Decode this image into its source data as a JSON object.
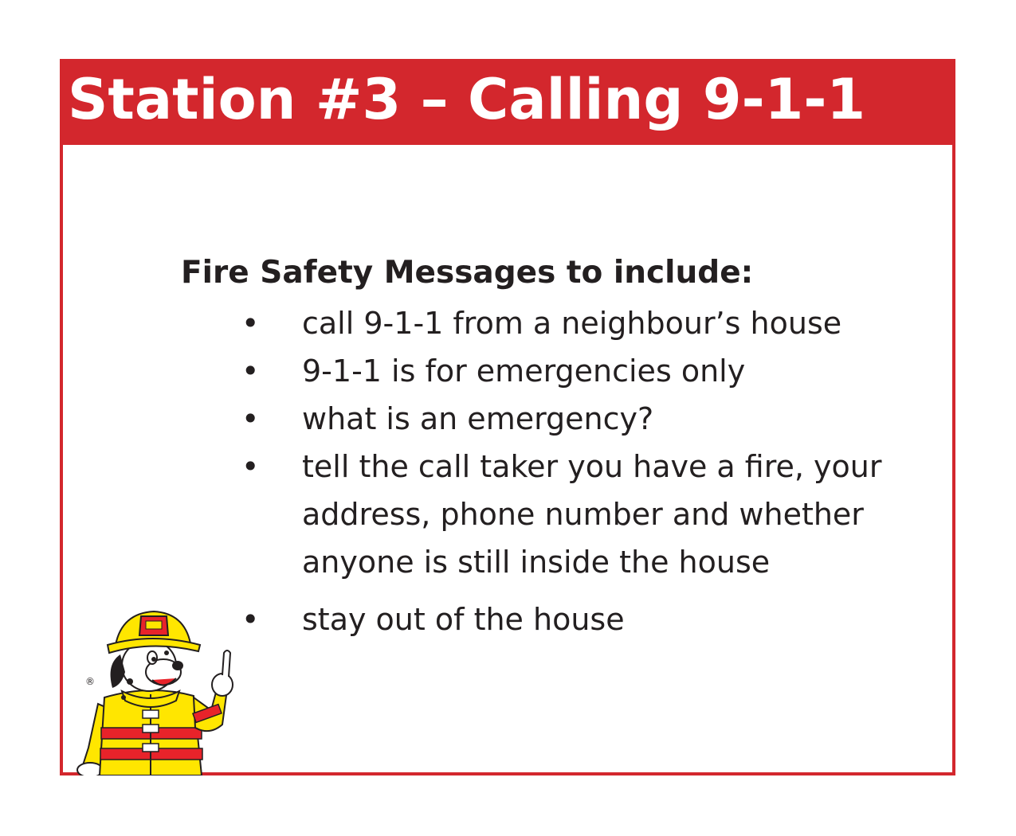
{
  "title": "Station #3 – Calling 9-1-1",
  "heading": "Fire Safety Messages to include:",
  "bullet_symbol": "•",
  "bullets": [
    "call 9-1-1 from a neighbour’s house",
    "9-1-1 is for emergencies only",
    "what is an emergency?",
    "tell the call taker you have a fire, your address, phone number and whether anyone is still inside the house",
    "stay out of the house"
  ],
  "mascot": {
    "icon": "firefighter-dog-mascot-icon",
    "mark": "®"
  },
  "colors": {
    "accent_red": "#d3272d",
    "text": "#231f20",
    "mascot_yellow": "#ffe600"
  }
}
